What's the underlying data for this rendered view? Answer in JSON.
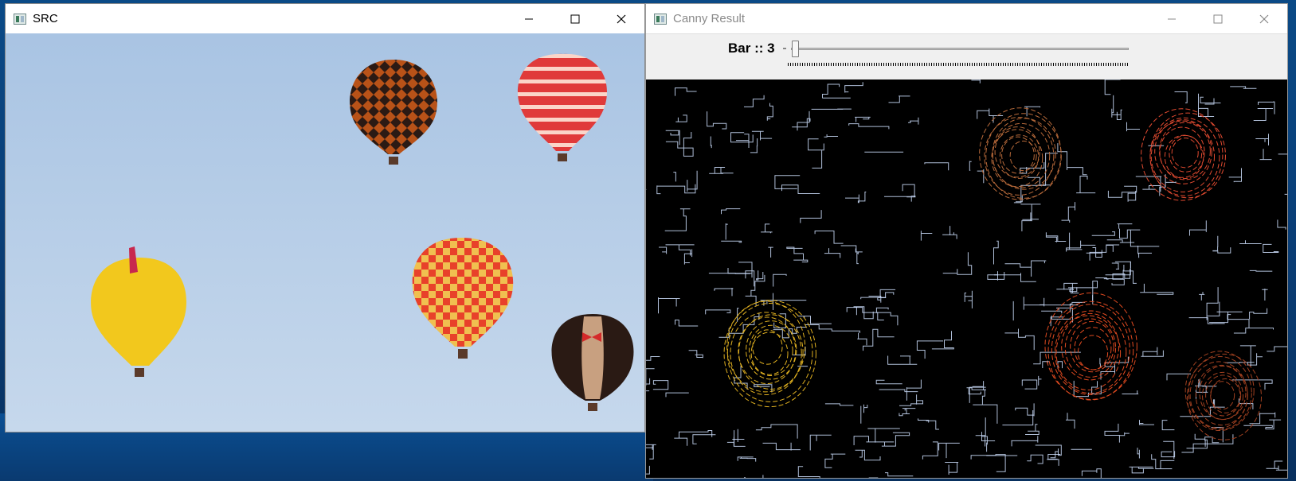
{
  "desktop": {
    "background_color": "#0a3f78"
  },
  "windows": {
    "src": {
      "title": "SRC",
      "icon": "app-window-icon",
      "controls": [
        "minimize-icon",
        "maximize-icon",
        "close-icon"
      ],
      "image": {
        "sky_color": "#b3cce6",
        "balloons": [
          {
            "name": "dark-patterned-balloon",
            "colors": [
              "#2b1a14",
              "#c75a1a"
            ]
          },
          {
            "name": "red-striped-balloon",
            "colors": [
              "#e03a3a",
              "#ffd6c8"
            ]
          },
          {
            "name": "yellow-balloon",
            "colors": [
              "#f2c81d",
              "#e6a610"
            ]
          },
          {
            "name": "checkered-balloon",
            "colors": [
              "#e8412a",
              "#f6c24a"
            ]
          },
          {
            "name": "tuxedo-balloon",
            "colors": [
              "#2a1a14",
              "#c8a080"
            ]
          }
        ]
      }
    },
    "canny": {
      "title": "Canny Result",
      "icon": "app-window-icon",
      "controls": [
        "minimize-icon",
        "maximize-icon",
        "close-icon"
      ],
      "trackbar": {
        "label": "Bar :: 3",
        "value": 3,
        "min": 0,
        "max": 255
      },
      "edge_image": {
        "background": "#000000",
        "edge_color": "#cfe0ff"
      }
    }
  }
}
